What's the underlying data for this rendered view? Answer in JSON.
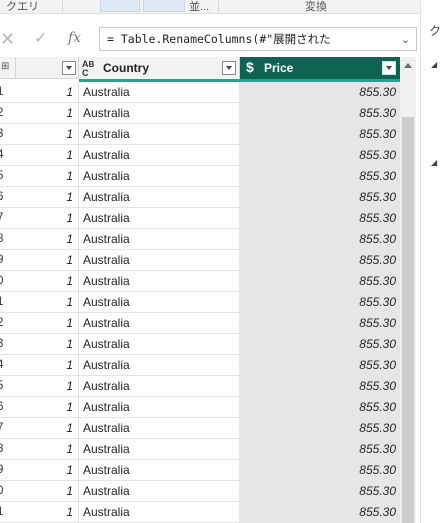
{
  "ribbon": {
    "query_group_label": "クエリ",
    "parallel_label": "並...",
    "transform_label": "変換"
  },
  "formula_bar": {
    "cancel_glyph": "✕",
    "commit_glyph": "✓",
    "fx_label": "fx",
    "formula": "= Table.RenameColumns(#\"展開された",
    "expand_glyph": "⌄"
  },
  "query_settings_pane": {
    "title_fragment": "ク"
  },
  "grid": {
    "index_header_glyph": "⊞",
    "columns": [
      {
        "name": "",
        "type_icon": "number-icon"
      },
      {
        "name": "Country",
        "type_icon": "text-type-icon",
        "type_glyph": "ABC"
      },
      {
        "name": "Price",
        "type_icon": "currency-type-icon",
        "type_glyph": "$",
        "selected": true
      }
    ],
    "rows": [
      {
        "idx": "1",
        "num": "1",
        "country": "Australia",
        "price": "855.30"
      },
      {
        "idx": "2",
        "num": "1",
        "country": "Australia",
        "price": "855.30"
      },
      {
        "idx": "3",
        "num": "1",
        "country": "Australia",
        "price": "855.30"
      },
      {
        "idx": "4",
        "num": "1",
        "country": "Australia",
        "price": "855.30"
      },
      {
        "idx": "5",
        "num": "1",
        "country": "Australia",
        "price": "855.30"
      },
      {
        "idx": "6",
        "num": "1",
        "country": "Australia",
        "price": "855.30"
      },
      {
        "idx": "7",
        "num": "1",
        "country": "Australia",
        "price": "855.30"
      },
      {
        "idx": "8",
        "num": "1",
        "country": "Australia",
        "price": "855.30"
      },
      {
        "idx": "9",
        "num": "1",
        "country": "Australia",
        "price": "855.30"
      },
      {
        "idx": "0",
        "num": "1",
        "country": "Australia",
        "price": "855.30"
      },
      {
        "idx": "1",
        "num": "1",
        "country": "Australia",
        "price": "855.30"
      },
      {
        "idx": "2",
        "num": "1",
        "country": "Australia",
        "price": "855.30"
      },
      {
        "idx": "3",
        "num": "1",
        "country": "Australia",
        "price": "855.30"
      },
      {
        "idx": "4",
        "num": "1",
        "country": "Australia",
        "price": "855.30"
      },
      {
        "idx": "5",
        "num": "1",
        "country": "Australia",
        "price": "855.30"
      },
      {
        "idx": "6",
        "num": "1",
        "country": "Australia",
        "price": "855.30"
      },
      {
        "idx": "7",
        "num": "1",
        "country": "Australia",
        "price": "855.30"
      },
      {
        "idx": "8",
        "num": "1",
        "country": "Australia",
        "price": "855.30"
      },
      {
        "idx": "9",
        "num": "1",
        "country": "Australia",
        "price": "855.30"
      },
      {
        "idx": "0",
        "num": "1",
        "country": "Australia",
        "price": "855.30"
      },
      {
        "idx": "1",
        "num": "1",
        "country": "Australia",
        "price": "855.30"
      }
    ]
  },
  "colors": {
    "selected_header_bg": "#0e6352",
    "header_accent_line": "#13a99a",
    "selected_column_bg": "#e6e6e6"
  }
}
